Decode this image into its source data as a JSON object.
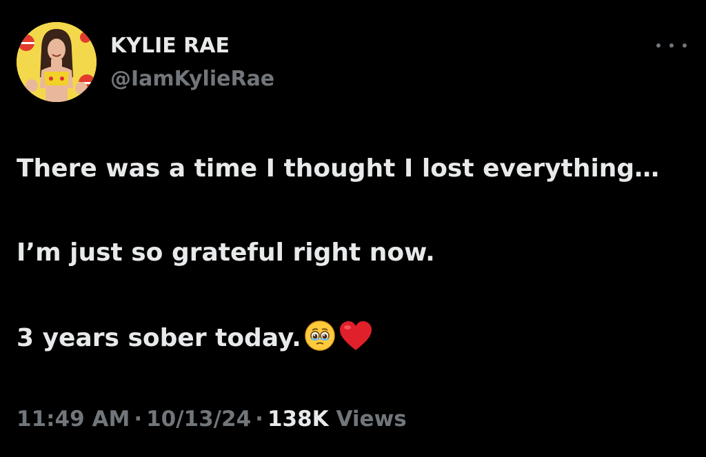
{
  "author": {
    "display_name": "KYLIE RAE",
    "handle": "@IamKylieRae"
  },
  "menu": {
    "more_icon": "more-horizontal-icon"
  },
  "tweet": {
    "line1": "There was a time I thought I lost everything…",
    "line2": "I’m just so grateful right now.",
    "line3": "3 years sober today.",
    "emojis": [
      "face-holding-back-tears-icon",
      "red-heart-icon"
    ]
  },
  "meta": {
    "time": "11:49 AM",
    "separator": "·",
    "date": "10/13/24",
    "views_count": "138K",
    "views_label": "Views"
  },
  "colors": {
    "background": "#000000",
    "primary_text": "#e7e9ea",
    "secondary_text": "#71767b",
    "heart": "#e0202a"
  }
}
